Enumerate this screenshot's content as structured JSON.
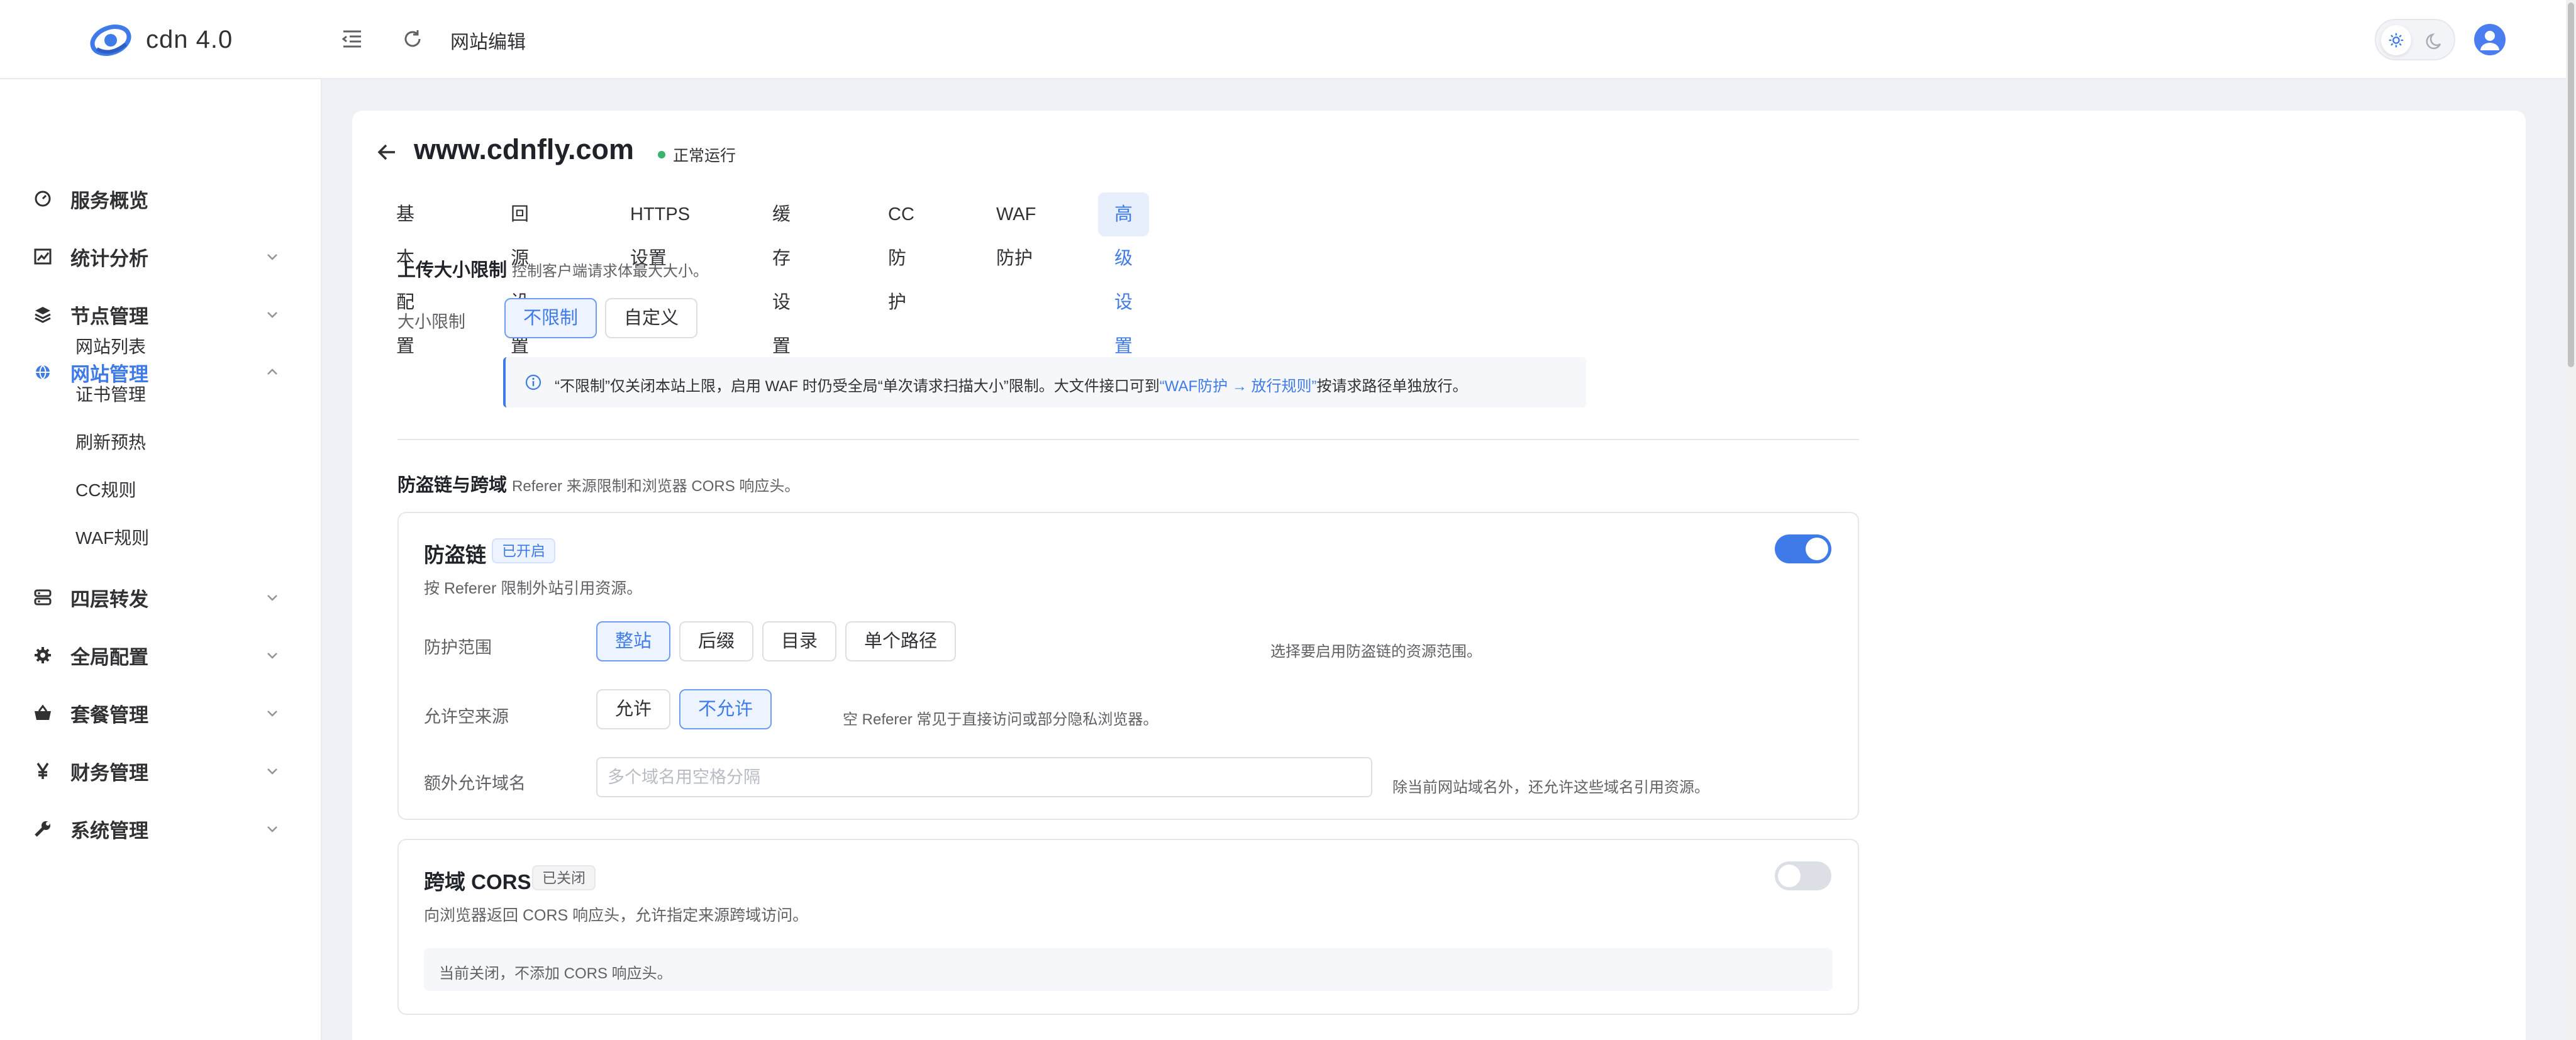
{
  "app": {
    "title": "cdn 4.0"
  },
  "topbar": {
    "page_title": "网站编辑"
  },
  "sidebar": {
    "items": [
      {
        "label": "服务概览",
        "icon": "dashboard-icon"
      },
      {
        "label": "统计分析",
        "icon": "chart-icon"
      },
      {
        "label": "节点管理",
        "icon": "layers-icon"
      },
      {
        "label": "网站管理",
        "icon": "globe-icon",
        "active": true
      },
      {
        "label": "四层转发",
        "icon": "server-icon"
      },
      {
        "label": "全局配置",
        "icon": "gear-icon"
      },
      {
        "label": "套餐管理",
        "icon": "basket-icon"
      },
      {
        "label": "财务管理",
        "icon": "yen-icon"
      },
      {
        "label": "系统管理",
        "icon": "wrench-icon"
      }
    ],
    "sub_items": [
      "网站列表",
      "证书管理",
      "刷新预热",
      "CC规则",
      "WAF规则"
    ]
  },
  "site": {
    "domain": "www.cdnfly.com",
    "status": "正常运行"
  },
  "tabs": [
    "基本配置",
    "回源设置",
    "HTTPS设置",
    "缓存设置",
    "CC防护",
    "WAF防护",
    "高级设置"
  ],
  "upload": {
    "title": "上传大小限制",
    "subtitle": "控制客户端请求体最大大小。",
    "size_label": "大小限制",
    "options": [
      "不限制",
      "自定义"
    ],
    "alert_before": "“不限制”仅关闭本站上限，启用 WAF 时仍受全局“单次请求扫描大小”限制。大文件接口可到",
    "alert_link": "“WAF防护 → 放行规则”",
    "alert_after": "按请求路径单独放行。"
  },
  "hotlink_section": {
    "title": "防盗链与跨域",
    "subtitle": "Referer 来源限制和浏览器 CORS 响应头。"
  },
  "hotlink": {
    "title": "防盗链",
    "badge": "已开启",
    "desc": "按 Referer 限制外站引用资源。",
    "scope_label": "防护范围",
    "scope_options": [
      "整站",
      "后缀",
      "目录",
      "单个路径"
    ],
    "scope_hint": "选择要启用防盗链的资源范围。",
    "empty_label": "允许空来源",
    "empty_options": [
      "允许",
      "不允许"
    ],
    "empty_hint": "空 Referer 常见于直接访问或部分隐私浏览器。",
    "extra_label": "额外允许域名",
    "extra_placeholder": "多个域名用空格分隔",
    "extra_hint": "除当前网站域名外，还允许这些域名引用资源。"
  },
  "cors": {
    "title": "跨域 CORS",
    "badge": "已关闭",
    "desc": "向浏览器返回 CORS 响应头，允许指定来源跨域访问。",
    "note": "当前关闭，不添加 CORS 响应头。"
  },
  "colors": {
    "accent": "#3f7be8",
    "success": "#3bb36b",
    "background": "#eef1f6"
  }
}
